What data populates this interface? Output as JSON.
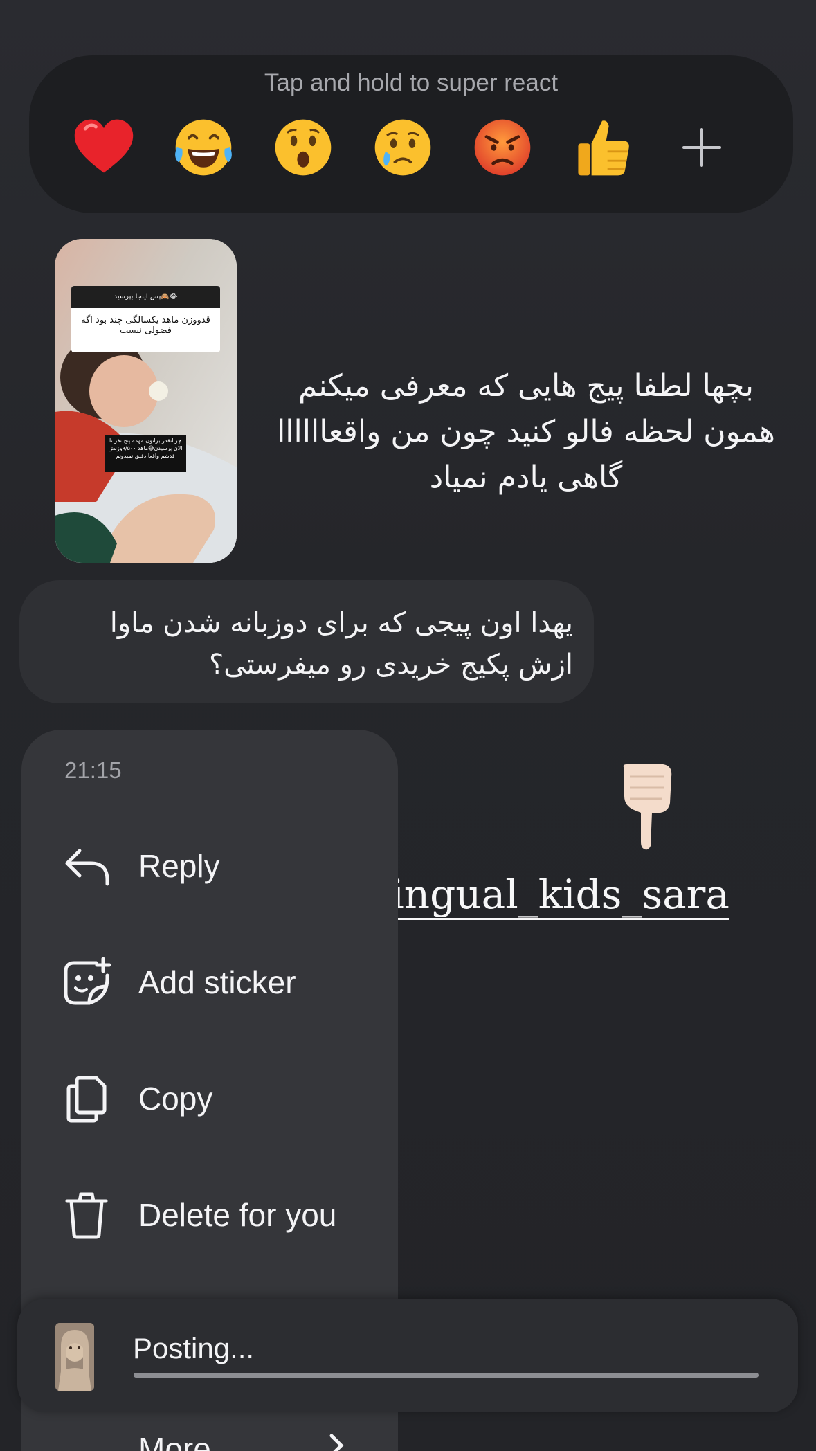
{
  "reactions": {
    "hint": "Tap and hold to super react",
    "emojis": [
      "red-heart",
      "face-with-tears-of-joy",
      "face-with-open-mouth",
      "crying-face",
      "angry-face",
      "thumbs-up"
    ],
    "more_icon": "plus-icon"
  },
  "story": {
    "card_header": "پس اینجا بپرسید🙈😂",
    "card_body": "قدووزن ماهد یکسالگی چند بود اگه فضولی نیست",
    "note": "چراانقدر براتون مهمه پنج نفر تا الان پرسیدن😅ماهد ۹/۵۰۰وزنش قدشم واقعا دقیق نمیدونم",
    "caption": "بچها لطفا پیج هایی که معرفی میکنم همون لحظه فالو کنید چون من واقعاااااا گاهی یادم نمیاد"
  },
  "message": {
    "text": "یهدا اون پیجی که برای دوزبانه شدن ماوا ازش پکیج خریدی رو میفرستی؟"
  },
  "menu": {
    "time": "21:15",
    "items": [
      {
        "label": "Reply",
        "icon": "reply-arrow-icon"
      },
      {
        "label": "Add sticker",
        "icon": "sticker-add-icon"
      },
      {
        "label": "Copy",
        "icon": "copy-icon"
      },
      {
        "label": "Delete for you",
        "icon": "trash-icon"
      }
    ],
    "more_label": "More"
  },
  "sticker": {
    "pointer": "backhand-index-pointing-down",
    "handle": "@bilingual_kids_sara"
  },
  "posting": {
    "label": "Posting...",
    "progress": 1.0
  },
  "colors": {
    "background": "#26272b",
    "bubble": "#2f3034",
    "menu": "#35363a",
    "react_bar": "#1d1e21"
  }
}
